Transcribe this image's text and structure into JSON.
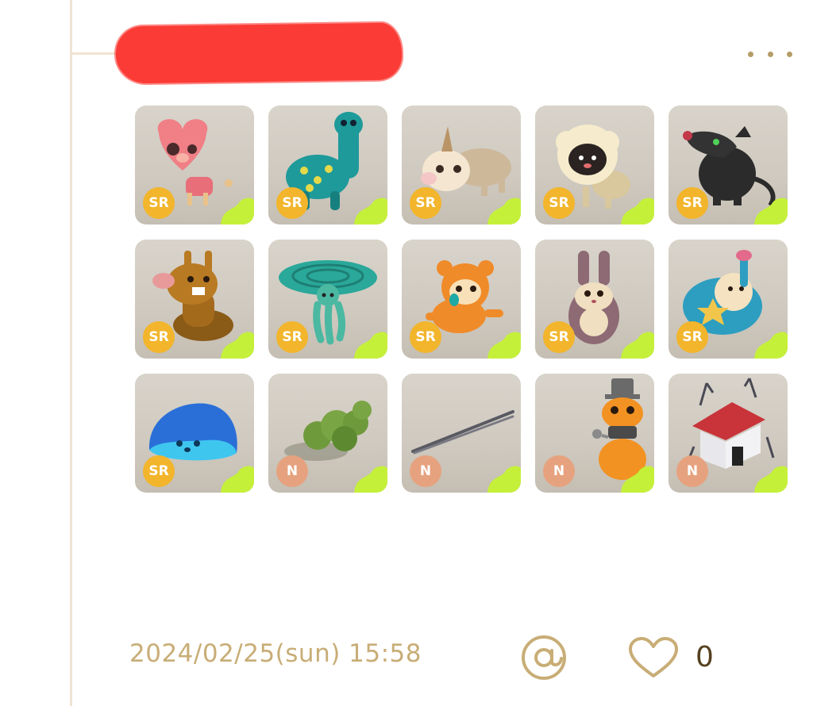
{
  "post": {
    "timestamp": "2024/02/25(sun) 15:58",
    "like_count": "0",
    "redaction_color": "#fb3b35",
    "accent_color": "#c8ad76"
  },
  "items": [
    {
      "rarity": "SR",
      "icon": "pink-heart-creature-icon"
    },
    {
      "rarity": "SR",
      "icon": "teal-dinosaur-icon"
    },
    {
      "rarity": "SR",
      "icon": "unicorn-boar-icon"
    },
    {
      "rarity": "SR",
      "icon": "sheep-icon"
    },
    {
      "rarity": "SR",
      "icon": "black-rat-icon"
    },
    {
      "rarity": "SR",
      "icon": "brown-bunny-snake-icon"
    },
    {
      "rarity": "SR",
      "icon": "spiral-jellyfish-icon"
    },
    {
      "rarity": "SR",
      "icon": "orange-monkey-icon"
    },
    {
      "rarity": "SR",
      "icon": "brown-rabbit-icon"
    },
    {
      "rarity": "SR",
      "icon": "blue-star-elephant-icon"
    },
    {
      "rarity": "SR",
      "icon": "blue-slime-icon"
    },
    {
      "rarity": "N",
      "icon": "green-shrub-icon"
    },
    {
      "rarity": "N",
      "icon": "tweezers-icon"
    },
    {
      "rarity": "N",
      "icon": "pumpkin-robot-icon"
    },
    {
      "rarity": "N",
      "icon": "haunted-house-icon"
    }
  ]
}
